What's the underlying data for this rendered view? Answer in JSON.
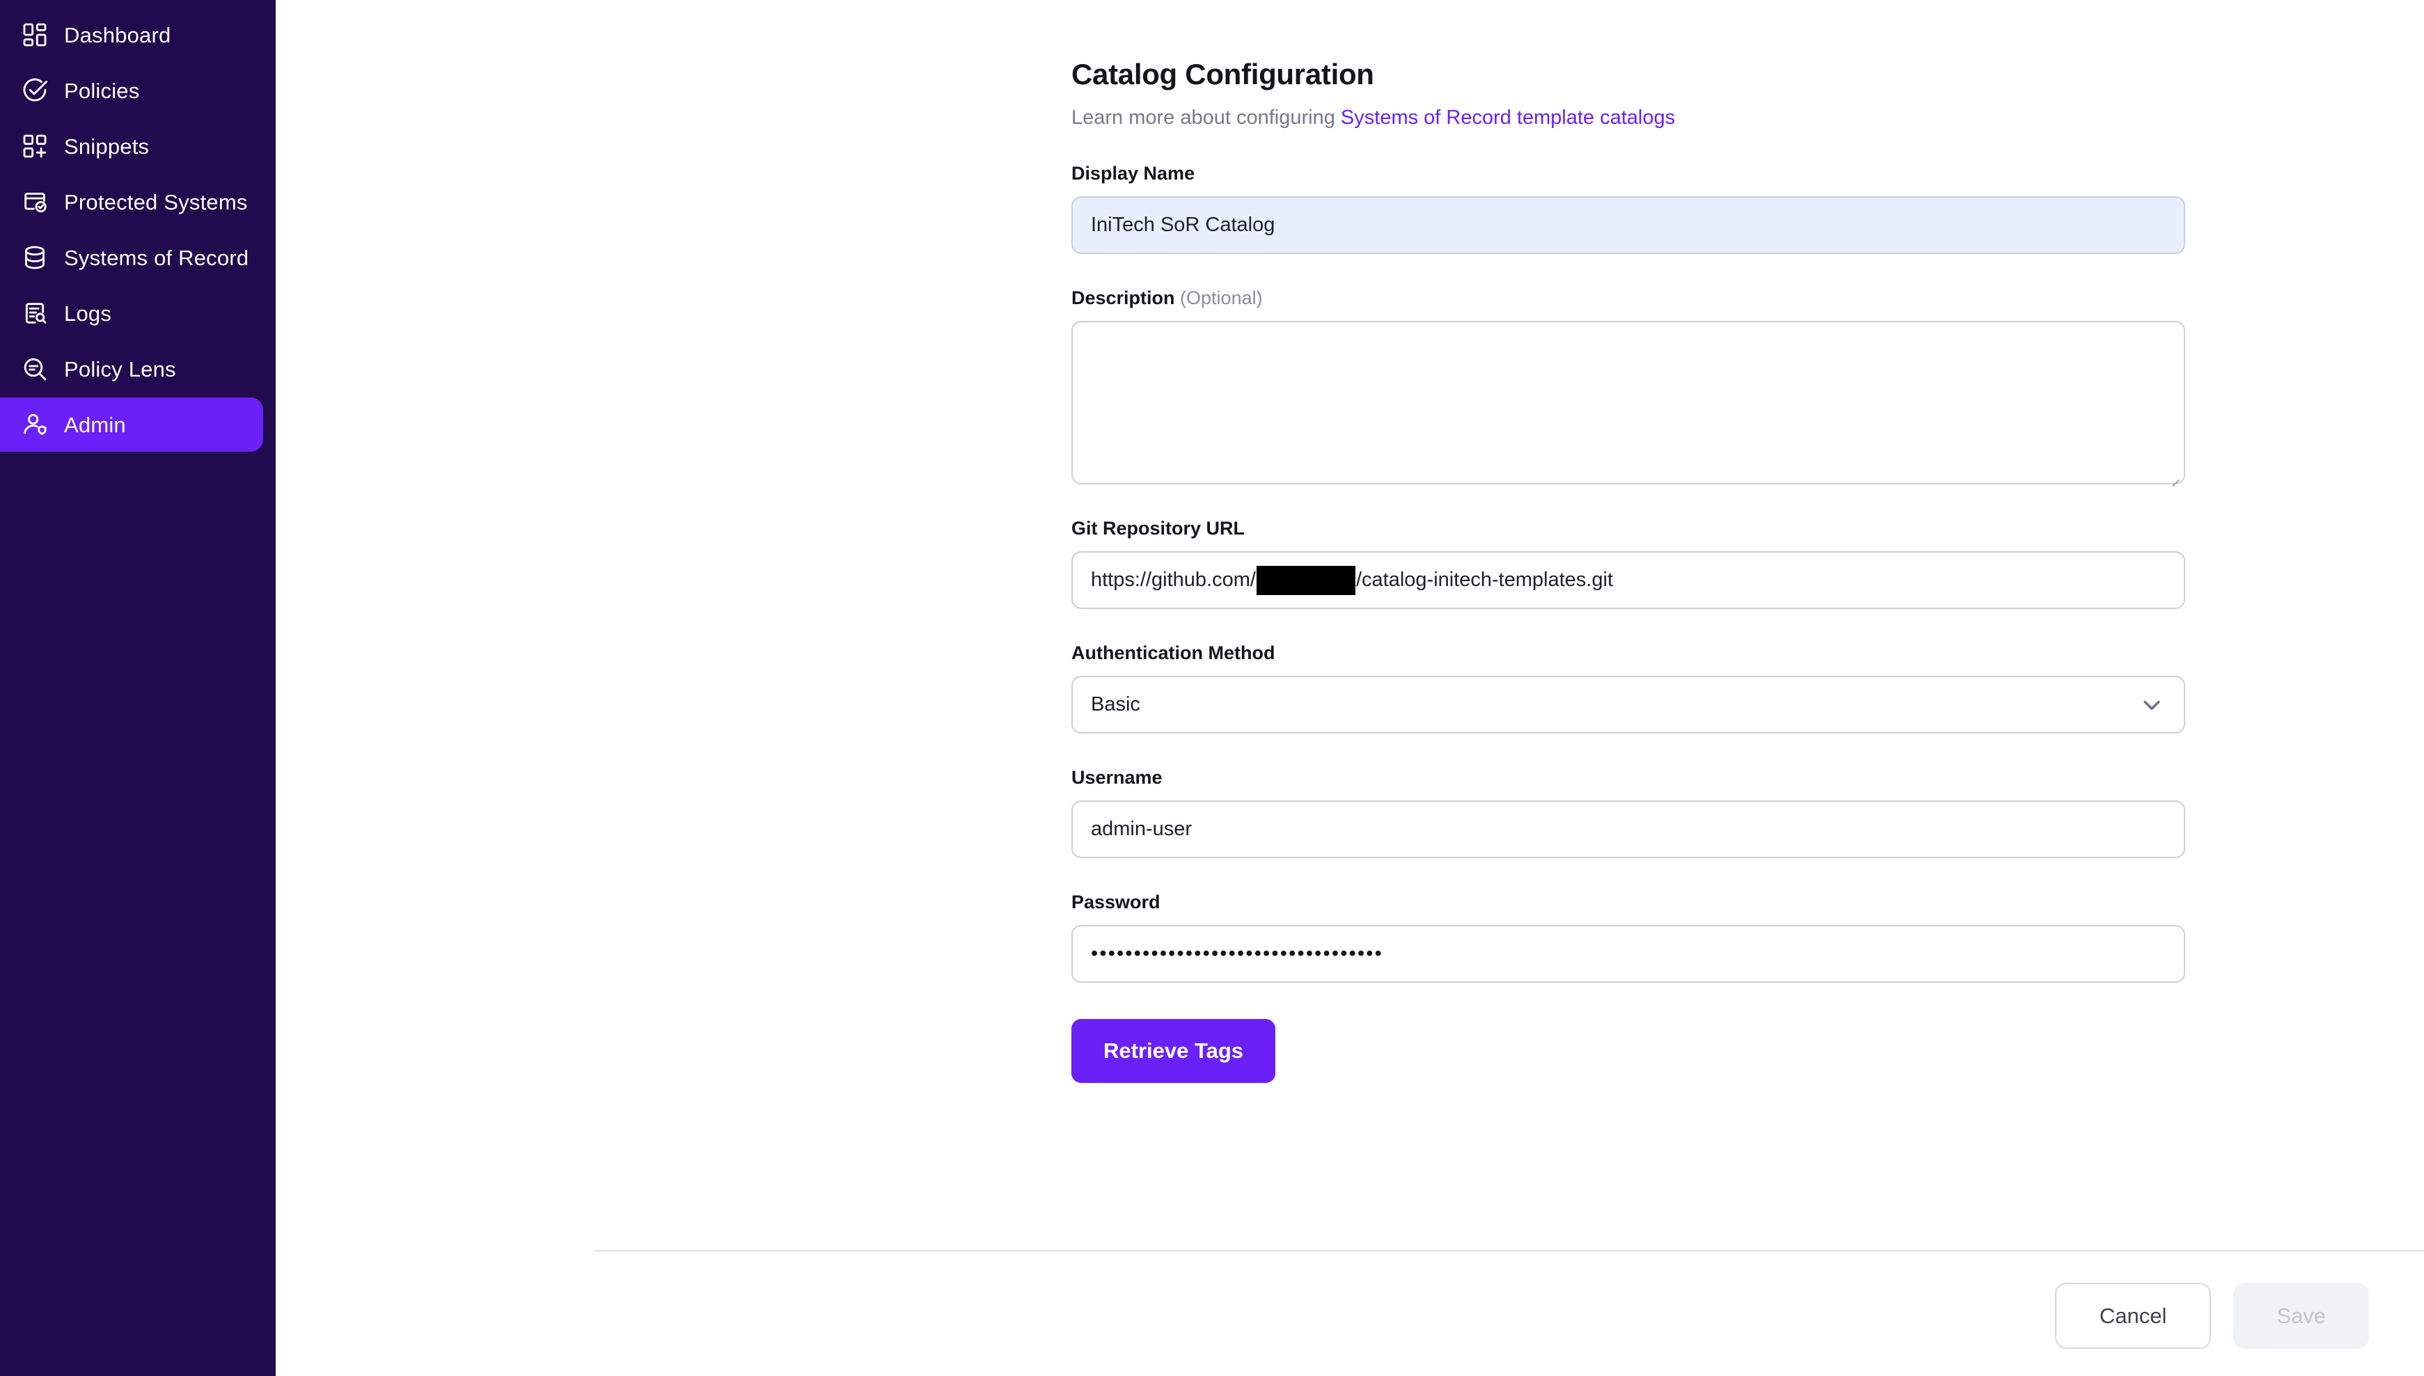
{
  "sidebar": {
    "background_color": "#210a4d",
    "active_color": "#6a21f7",
    "items": [
      {
        "label": "Dashboard",
        "icon": "dashboard-grid-icon",
        "active": false
      },
      {
        "label": "Policies",
        "icon": "check-circle-icon",
        "active": false
      },
      {
        "label": "Snippets",
        "icon": "grid-plus-icon",
        "active": false
      },
      {
        "label": "Protected Systems",
        "icon": "shield-window-icon",
        "active": false
      },
      {
        "label": "Systems of Record",
        "icon": "database-icon",
        "active": false
      },
      {
        "label": "Logs",
        "icon": "document-search-icon",
        "active": false
      },
      {
        "label": "Policy Lens",
        "icon": "magnifier-lines-icon",
        "active": false
      },
      {
        "label": "Admin",
        "icon": "user-shield-icon",
        "active": true
      }
    ]
  },
  "page": {
    "title": "Catalog Configuration",
    "subtitle_prefix": "Learn more about configuring ",
    "subtitle_link": "Systems of Record template catalogs",
    "link_color": "#6a21f7"
  },
  "form": {
    "display_name": {
      "label": "Display Name",
      "value": "IniTech SoR Catalog",
      "placeholder": "",
      "background_color": "#e8eefb"
    },
    "description": {
      "label": "Description",
      "optional_suffix": "(Optional)",
      "value": "",
      "placeholder": ""
    },
    "git_url": {
      "label": "Git Repository URL",
      "value_prefix": "https://github.com/",
      "value_redacted": true,
      "value_suffix": "/catalog-initech-templates.git",
      "placeholder": ""
    },
    "auth_method": {
      "label": "Authentication Method",
      "selected": "Basic",
      "chevron_icon": "chevron-down-icon"
    },
    "username": {
      "label": "Username",
      "value": "admin-user",
      "placeholder": ""
    },
    "password": {
      "label": "Password",
      "value": "••••••••••••••••••••••••••••••••••",
      "placeholder": ""
    },
    "retrieve_tags_label": "Retrieve Tags"
  },
  "footer": {
    "cancel_label": "Cancel",
    "save_label": "Save",
    "save_disabled": true
  }
}
